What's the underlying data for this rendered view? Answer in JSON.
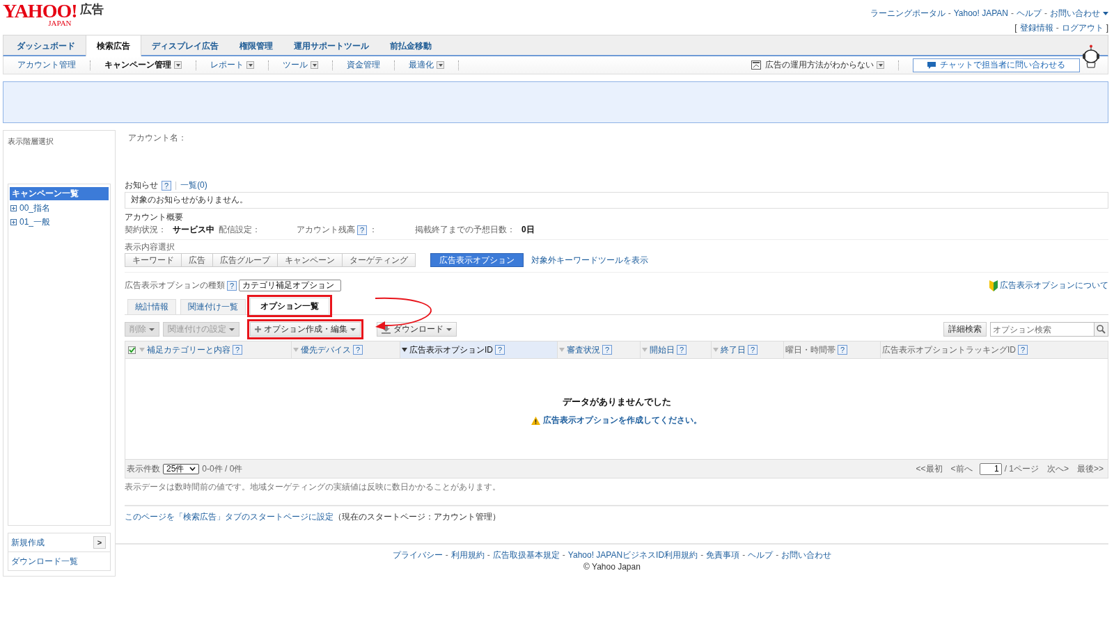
{
  "header": {
    "logo": {
      "brand": "YAHOO!",
      "sub": "JAPAN",
      "product": "広告"
    },
    "top_links": [
      {
        "label": "ラーニングポータル"
      },
      {
        "label": "Yahoo! JAPAN"
      },
      {
        "label": "ヘルプ"
      },
      {
        "label": "お問い合わせ",
        "dropdown": true
      }
    ],
    "separator": "-",
    "account_links": {
      "open": "[",
      "close": "]",
      "links": [
        "登録情報",
        "ログアウト"
      ]
    }
  },
  "main_tabs": [
    {
      "label": "ダッシュボード",
      "selected": false
    },
    {
      "label": "検索広告",
      "selected": true
    },
    {
      "label": "ディスプレイ広告",
      "selected": false
    },
    {
      "label": "権限管理",
      "selected": false
    },
    {
      "label": "運用サポートツール",
      "selected": false
    },
    {
      "label": "前払金移動",
      "selected": false
    }
  ],
  "sub_nav": [
    {
      "label": "アカウント管理",
      "selected": false,
      "dropdown": false
    },
    {
      "label": "キャンペーン管理",
      "selected": true,
      "dropdown": true
    },
    {
      "label": "レポート",
      "selected": false,
      "dropdown": true
    },
    {
      "label": "ツール",
      "selected": false,
      "dropdown": true
    },
    {
      "label": "資金管理",
      "selected": false,
      "dropdown": false
    },
    {
      "label": "最適化",
      "selected": false,
      "dropdown": true
    }
  ],
  "help_menu": {
    "label": "広告の運用方法がわからない"
  },
  "chat_button": {
    "label": "チャットで担当者に問い合わせる"
  },
  "sidebar": {
    "title": "表示階層選択",
    "tree_title": "キャンペーン一覧",
    "items": [
      {
        "label": "00_指名",
        "expanded": false
      },
      {
        "label": "01_一般",
        "expanded": false
      }
    ],
    "new_item": {
      "label": "新規作成",
      "arrow": ">"
    },
    "download_list": "ダウンロード一覧"
  },
  "account_name_label": "アカウント名：",
  "notice": {
    "label": "お知らせ",
    "help": "?",
    "separator": "|",
    "list_link": "一覧(0)",
    "message": "対象のお知らせがありません。"
  },
  "account_summary": {
    "title": "アカウント概要",
    "fields": [
      {
        "label": "契約状況：",
        "value": "サービス中"
      },
      {
        "label": "配信設定："
      },
      {
        "label": "アカウント残高",
        "help": "?",
        "suffix": "："
      },
      {
        "label": "掲載終了までの予想日数：",
        "value": "0日"
      }
    ]
  },
  "view_select": {
    "label": "表示内容選択",
    "options": [
      {
        "label": "キーワード",
        "selected": false
      },
      {
        "label": "広告",
        "selected": false
      },
      {
        "label": "広告グループ",
        "selected": false
      },
      {
        "label": "キャンペーン",
        "selected": false
      },
      {
        "label": "ターゲティング",
        "selected": false
      },
      {
        "label": "広告表示オプション",
        "selected": true
      }
    ],
    "link": "対象外キーワードツールを表示"
  },
  "option_type": {
    "label": "広告表示オプションの種類",
    "help": "?",
    "value": "カテゴリ補足オプション",
    "about_link": "広告表示オプションについて"
  },
  "sub_tabs": [
    {
      "label": "統計情報",
      "selected": false,
      "highlighted": false
    },
    {
      "label": "関連付け一覧",
      "selected": false,
      "highlighted": false
    },
    {
      "label": "オプション一覧",
      "selected": true,
      "highlighted": true
    }
  ],
  "toolbar": {
    "buttons": [
      {
        "label": "削除",
        "kind": "plain",
        "disabled": true,
        "highlighted": false
      },
      {
        "label": "関連付けの設定",
        "kind": "plain",
        "disabled": true,
        "highlighted": false
      },
      {
        "label": "オプション作成・編集",
        "kind": "plus",
        "disabled": false,
        "highlighted": true
      },
      {
        "label": "ダウンロード",
        "kind": "download",
        "disabled": false,
        "highlighted": false
      }
    ],
    "detail_search": "詳細検索",
    "search": {
      "placeholder": "オプション検索"
    }
  },
  "table": {
    "select_all": {
      "checked": true
    },
    "columns": [
      {
        "label": "補足カテゴリーと内容",
        "help": "?",
        "sortable": true,
        "sorted": false
      },
      {
        "label": "優先デバイス",
        "help": "?",
        "sortable": true,
        "sorted": false
      },
      {
        "label": "広告表示オプションID",
        "help": "?",
        "sortable": true,
        "sorted": true
      },
      {
        "label": "審査状況",
        "help": "?",
        "sortable": true,
        "sorted": false
      },
      {
        "label": "開始日",
        "help": "?",
        "sortable": true,
        "sorted": false
      },
      {
        "label": "終了日",
        "help": "?",
        "sortable": true,
        "sorted": false
      },
      {
        "label": "曜日・時間帯",
        "help": "?",
        "sortable": false,
        "sorted": false
      },
      {
        "label": "広告表示オプショントラッキングID",
        "help": "?",
        "sortable": false,
        "sorted": false
      }
    ],
    "empty": {
      "title": "データがありませんでした",
      "message": "広告表示オプションを作成してください。"
    },
    "footer": {
      "per_page_label": "表示件数",
      "per_page": "25件",
      "range": "0-0件 / 0件",
      "first": "<<最初",
      "prev": "<前へ",
      "page": "1",
      "total": "/ 1ページ",
      "next": "次へ>",
      "last": "最後>>"
    }
  },
  "note": "表示データは数時間前の値です。地域ターゲティングの実績値は反映に数日かかることがあります。",
  "start_page": {
    "link": "このページを「検索広告」タブのスタートページに設定",
    "text": "（現在のスタートページ：アカウント管理）"
  },
  "footer": {
    "links": [
      "プライバシー",
      "利用規約",
      "広告取扱基本規定",
      "Yahoo! JAPANビジネスID利用規約",
      "免責事項",
      "ヘルプ",
      "お問い合わせ"
    ],
    "separator": "-",
    "copyright": "© Yahoo Japan"
  }
}
